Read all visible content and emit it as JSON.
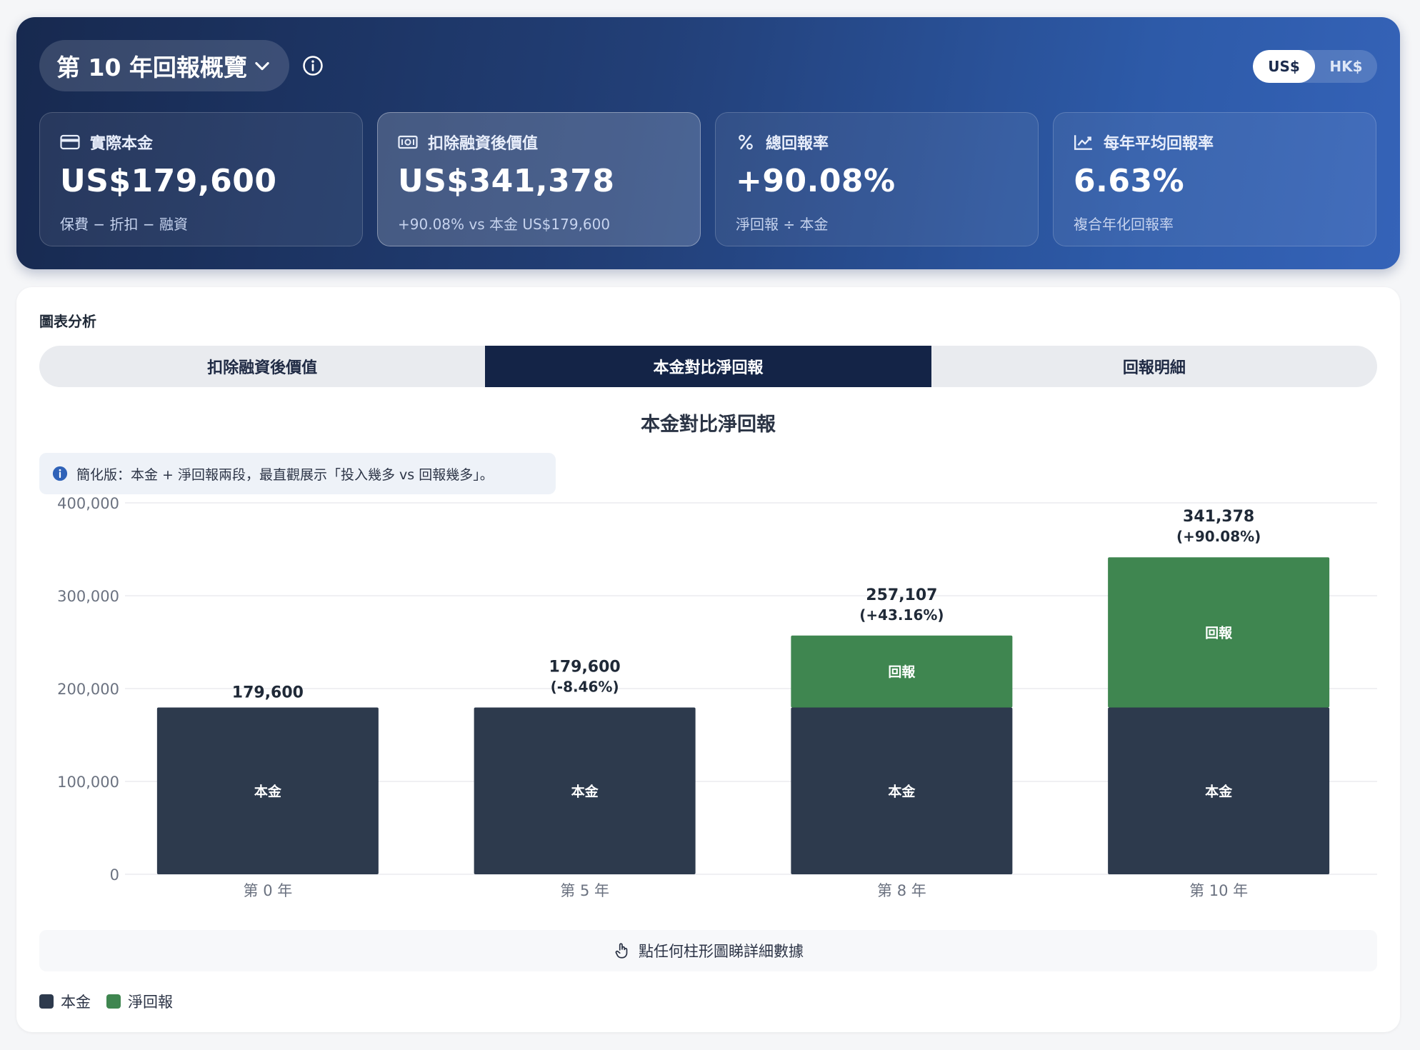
{
  "header": {
    "year_selector": "第 10 年回報概覽",
    "currency": {
      "options": [
        "US$",
        "HK$"
      ],
      "selected": "US$"
    }
  },
  "stats": [
    {
      "icon": "card-icon",
      "label": "實際本金",
      "value": "US$179,600",
      "sub": "保費 − 折扣 − 融資"
    },
    {
      "icon": "cash-icon",
      "label": "扣除融資後價值",
      "value": "US$341,378",
      "sub": "+90.08% vs 本金 US$179,600"
    },
    {
      "icon": "percent-icon",
      "label": "總回報率",
      "value": "+90.08%",
      "sub": "淨回報 ÷ 本金"
    },
    {
      "icon": "trend-icon",
      "label": "每年平均回報率",
      "value": "6.63%",
      "sub": "複合年化回報率"
    }
  ],
  "panel": {
    "title": "圖表分析",
    "tabs": [
      {
        "label": "扣除融資後價值",
        "active": false
      },
      {
        "label": "本金對比淨回報",
        "active": true
      },
      {
        "label": "回報明細",
        "active": false
      }
    ],
    "chart_title": "本金對比淨回報",
    "note": "簡化版：本金 + 淨回報兩段，最直觀展示「投入幾多 vs 回報幾多」。",
    "hint": "點任何柱形圖睇詳細數據",
    "legend": [
      {
        "label": "本金",
        "color": "#2d3a4d"
      },
      {
        "label": "淨回報",
        "color": "#3f8650"
      }
    ]
  },
  "colors": {
    "principal": "#2d3a4d",
    "return": "#3f8650",
    "accent_dark": "#142447"
  },
  "chart_data": {
    "type": "bar",
    "stacked": true,
    "categories": [
      "第 0 年",
      "第 5 年",
      "第 8 年",
      "第 10 年"
    ],
    "series": [
      {
        "name": "本金",
        "segment_label": "本金",
        "values": [
          179600,
          179600,
          179600,
          179600
        ]
      },
      {
        "name": "淨回報",
        "segment_label": "回報",
        "values": [
          0,
          0,
          77507,
          161778
        ]
      }
    ],
    "totals": [
      179600,
      179600,
      257107,
      341378
    ],
    "total_labels": [
      "179,600",
      "179,600",
      "257,107",
      "341,378"
    ],
    "pct_labels": [
      "",
      "(-8.46%)",
      "(+43.16%)",
      "(+90.08%)"
    ],
    "y_ticks": [
      0,
      100000,
      200000,
      300000,
      400000
    ],
    "y_tick_labels": [
      "0",
      "100,000",
      "200,000",
      "300,000",
      "400,000"
    ],
    "ylim": [
      0,
      400000
    ],
    "grid": true,
    "legend_position": "bottom-left"
  }
}
